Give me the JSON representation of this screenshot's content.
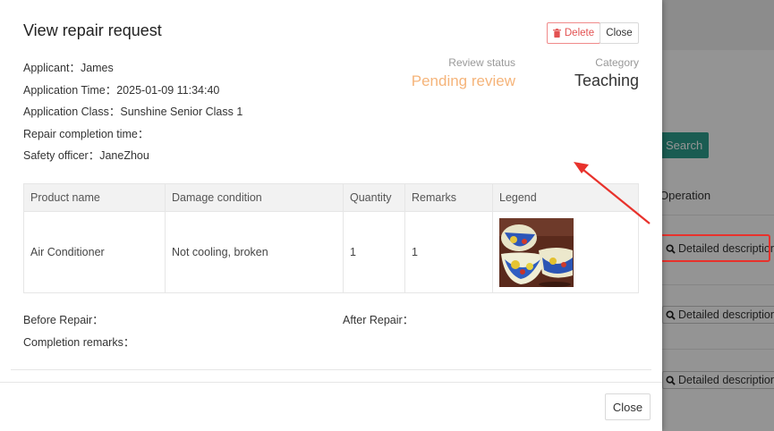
{
  "background": {
    "search_label": "Search",
    "operation_header": "Operation",
    "detail_buttons": [
      "Detailed description",
      "Detailed description",
      "Detailed description"
    ]
  },
  "modal": {
    "title": "View repair request",
    "delete_label": "Delete",
    "close_top_label": "Close",
    "close_bottom_label": "Close",
    "fields": [
      {
        "label": "Applicant：",
        "value": "James"
      },
      {
        "label": "Application Time：",
        "value": "2025-01-09 11:34:40"
      },
      {
        "label": "Application Class：",
        "value": "Sunshine Senior Class 1"
      },
      {
        "label": "Repair completion time：",
        "value": ""
      },
      {
        "label": "Safety officer：",
        "value": "JaneZhou"
      }
    ],
    "review_status": {
      "label": "Review status",
      "value": "Pending review",
      "color": "#f5b47a"
    },
    "category": {
      "label": "Category",
      "value": "Teaching"
    },
    "table": {
      "headers": [
        "Product name",
        "Damage condition",
        "Quantity",
        "Remarks",
        "Legend"
      ],
      "rows": [
        {
          "product": "Air Conditioner",
          "damage": "Not cooling, broken",
          "quantity": "1",
          "remarks": "1",
          "legend": "porcelain-bowl-photo"
        }
      ]
    },
    "before_repair_label": "Before Repair：",
    "after_repair_label": "After Repair：",
    "completion_remarks_label": "Completion remarks："
  },
  "colors": {
    "accent_teal": "#2d9f8e",
    "danger": "#e35151",
    "annotation_red": "#e8322c"
  }
}
